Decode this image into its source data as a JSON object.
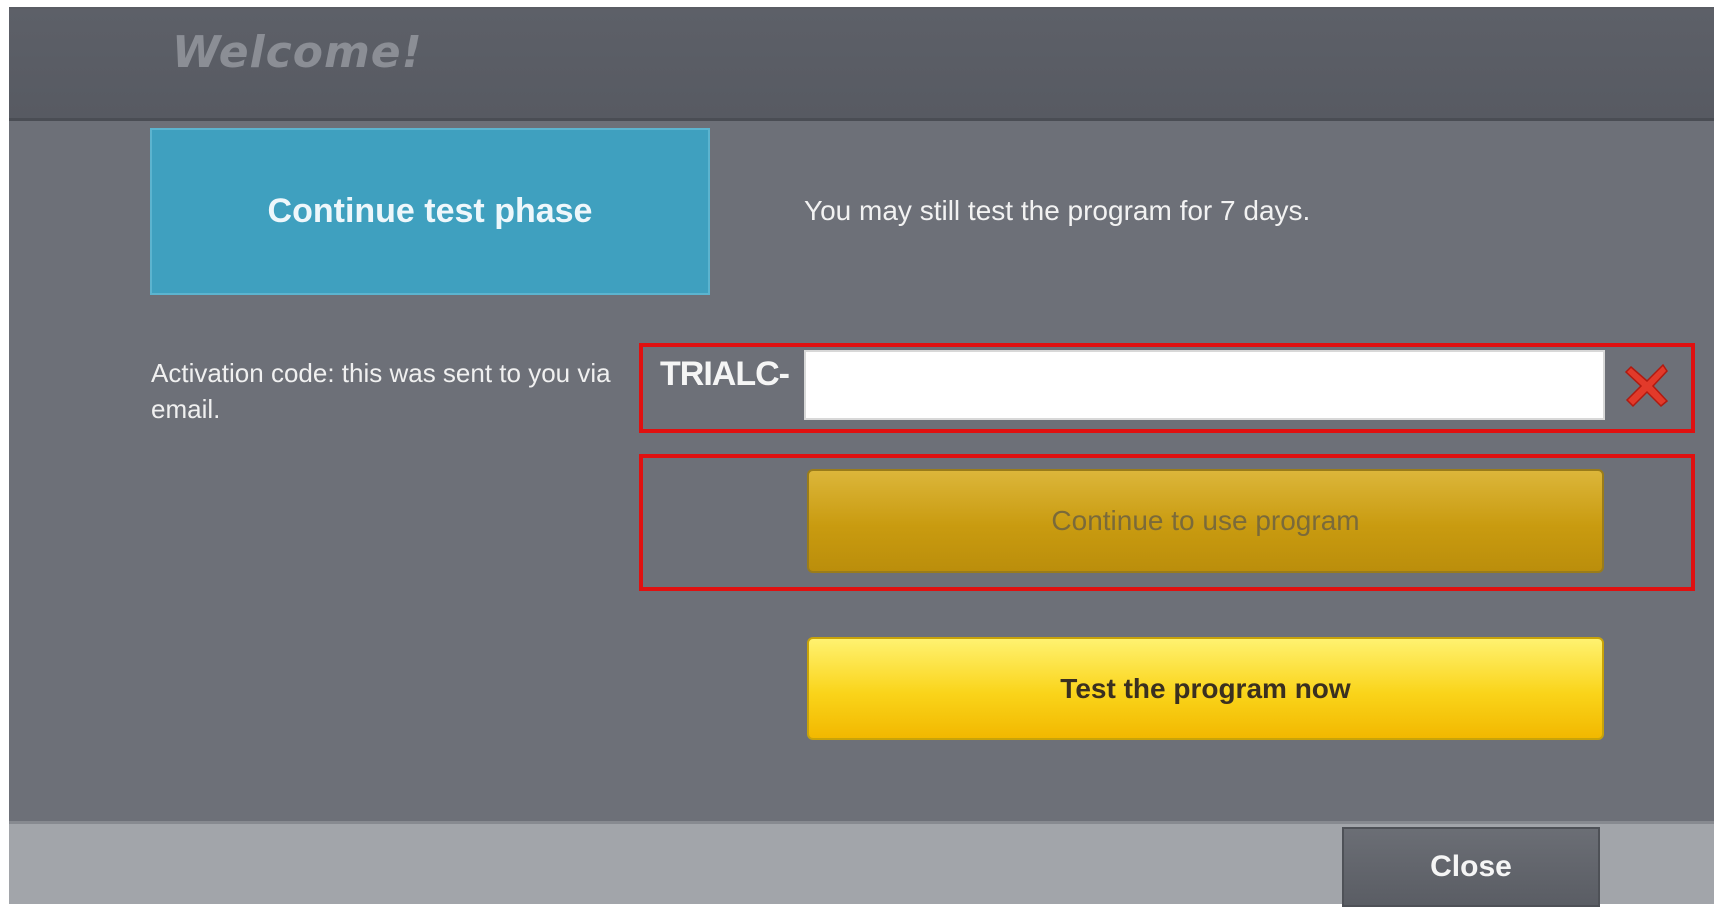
{
  "window": {
    "title": "Welcome!"
  },
  "trial": {
    "button_label": "Continue test phase",
    "info_text": "You may still test the program for 7 days."
  },
  "activation": {
    "label": "Activation code: this was sent to you via email.",
    "prefix": "TRIALC-",
    "input_value": "",
    "clear_icon": "red-x-icon"
  },
  "actions": {
    "continue_label": "Continue to use program",
    "test_label": "Test the program now"
  },
  "footer": {
    "close_label": "Close"
  },
  "colors": {
    "window_bg": "#6d7078",
    "trial_button": "#3fa0bf",
    "continue_button": "#c99b10",
    "test_button": "#fad41a",
    "highlight": "#e01010"
  }
}
